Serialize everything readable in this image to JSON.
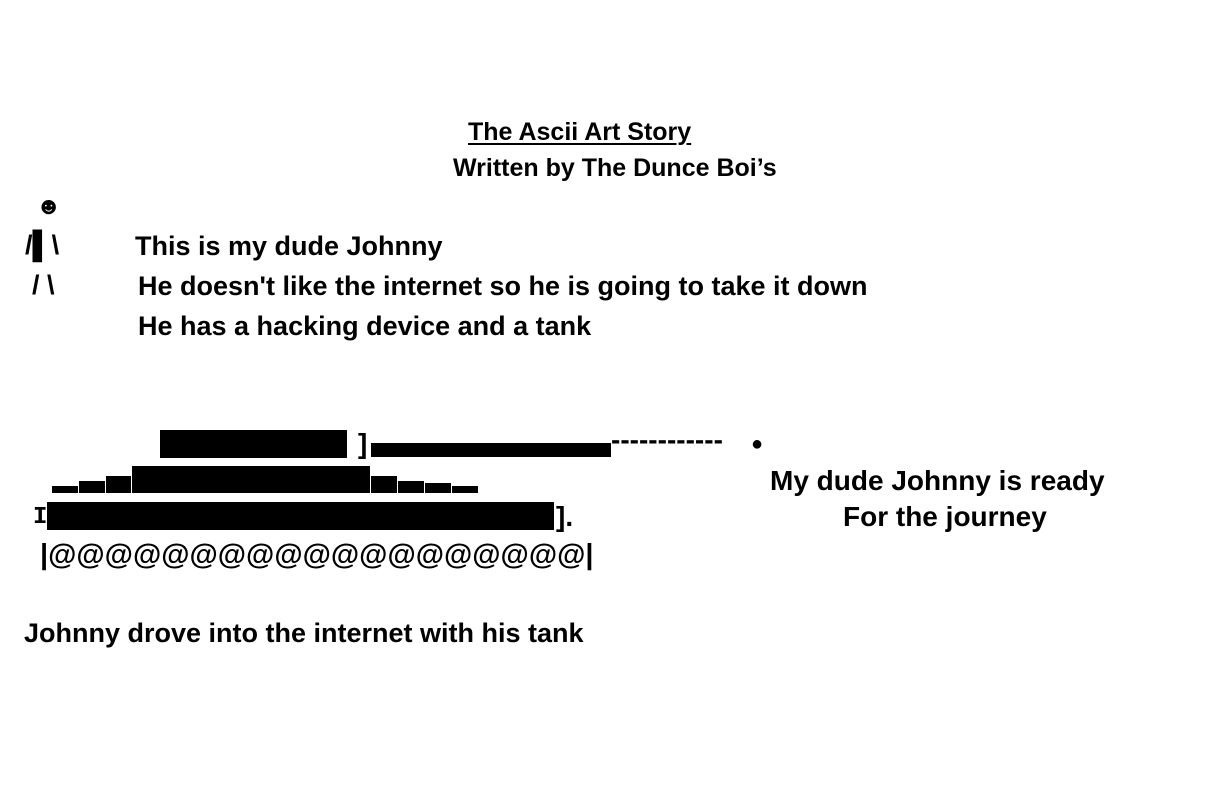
{
  "title": "The Ascii Art Story",
  "byline": "Written by The Dunce Boi’s",
  "figure": {
    "head": "☻",
    "torso": "/▌\\",
    "legs": "/ \\"
  },
  "story": {
    "line1": "This is my dude Johnny",
    "line2": "He doesn't like the internet so he is going to take it down",
    "line3": "He has a hacking device and a tank"
  },
  "tank": {
    "turret_bracket": "]",
    "barrel_dashes": "------------",
    "barrel_tip": "●",
    "hull_left": "I",
    "hull_right": "].",
    "wheels": "|@@@@@@@@@@@@@@@@@@@|"
  },
  "caption": {
    "ready": "My dude Johnny is ready",
    "journey": "For the journey"
  },
  "closing": "Johnny drove into the internet with his tank"
}
